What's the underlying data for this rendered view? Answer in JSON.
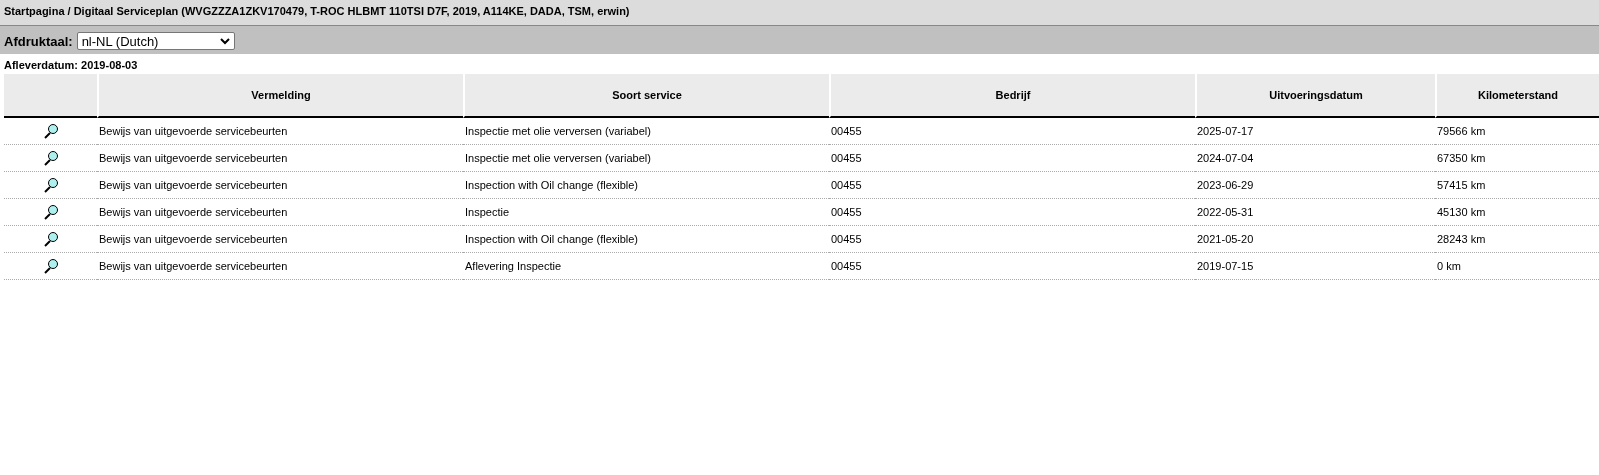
{
  "breadcrumb": "Startpagina / Digitaal Serviceplan (WVGZZZA1ZKV170479, T-ROC HLBMT 110TSI D7F, 2019, A114KE, DADA, TSM, erwin)",
  "language": {
    "label": "Afdruktaal:",
    "value": "nl-NL (Dutch)"
  },
  "delivery_date": "Afleverdatum: 2019-08-03",
  "table": {
    "columns": [
      "Vermelding",
      "Soort service",
      "Bedrijf",
      "Uitvoeringsdatum",
      "Kilometerstand"
    ],
    "rows": [
      {
        "entry": "Bewijs van uitgevoerde servicebeurten",
        "service_type": "Inspectie met olie verversen (variabel)",
        "company": "00455",
        "date": "2025-07-17",
        "mileage": "79566 km"
      },
      {
        "entry": "Bewijs van uitgevoerde servicebeurten",
        "service_type": "Inspectie met olie verversen (variabel)",
        "company": "00455",
        "date": "2024-07-04",
        "mileage": "67350 km"
      },
      {
        "entry": "Bewijs van uitgevoerde servicebeurten",
        "service_type": "Inspection with Oil change (flexible)",
        "company": "00455",
        "date": "2023-06-29",
        "mileage": "57415 km"
      },
      {
        "entry": "Bewijs van uitgevoerde servicebeurten",
        "service_type": "Inspectie",
        "company": "00455",
        "date": "2022-05-31",
        "mileage": "45130 km"
      },
      {
        "entry": "Bewijs van uitgevoerde servicebeurten",
        "service_type": "Inspection with Oil change (flexible)",
        "company": "00455",
        "date": "2021-05-20",
        "mileage": "28243 km"
      },
      {
        "entry": "Bewijs van uitgevoerde servicebeurten",
        "service_type": "Aflevering Inspectie",
        "company": "00455",
        "date": "2019-07-15",
        "mileage": "0 km"
      }
    ]
  }
}
